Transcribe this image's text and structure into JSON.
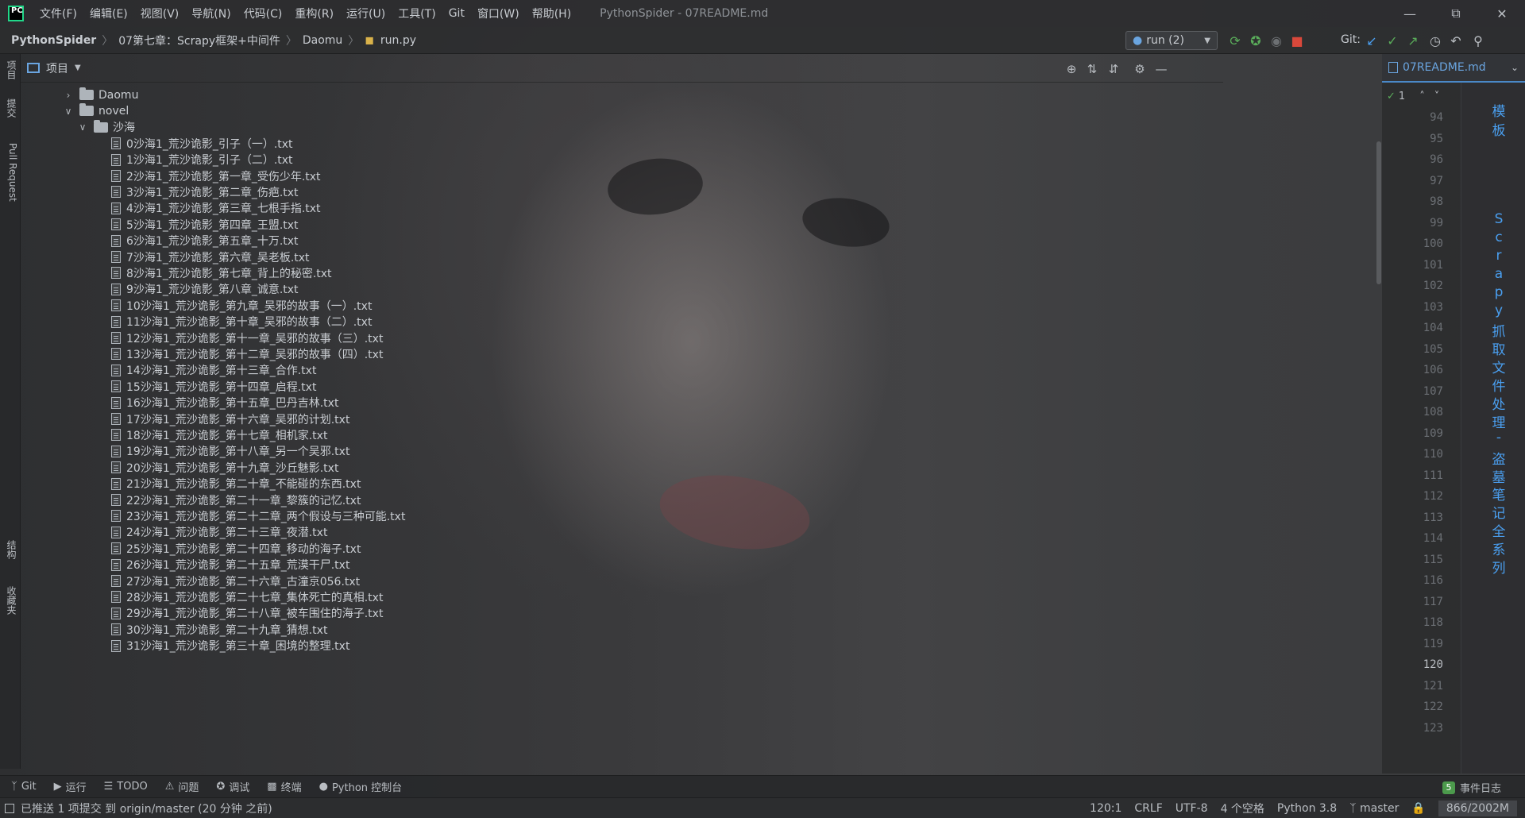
{
  "menu": {
    "items": [
      "文件(F)",
      "编辑(E)",
      "视图(V)",
      "导航(N)",
      "代码(C)",
      "重构(R)",
      "运行(U)",
      "工具(T)",
      "Git",
      "窗口(W)",
      "帮助(H)"
    ],
    "window_title": "PythonSpider - 07README.md"
  },
  "breadcrumb": {
    "items": [
      "PythonSpider",
      "07第七章：Scrapy框架+中间件",
      "Daomu",
      "run.py"
    ]
  },
  "toolbar": {
    "run_config": "run (2)",
    "git_label": "Git:"
  },
  "left_strip": {
    "tabs": [
      "项目",
      "提交",
      "Pull Request",
      "结构",
      "收藏夹"
    ]
  },
  "project_panel": {
    "title": "项目"
  },
  "tree": {
    "folders": [
      {
        "label": "Daomu",
        "expanded": false
      },
      {
        "label": "novel",
        "expanded": true
      },
      {
        "label": "沙海",
        "expanded": true
      }
    ],
    "files": [
      "0沙海1_荒沙诡影_引子（一）.txt",
      "1沙海1_荒沙诡影_引子（二）.txt",
      "2沙海1_荒沙诡影_第一章_受伤少年.txt",
      "3沙海1_荒沙诡影_第二章_伤疤.txt",
      "4沙海1_荒沙诡影_第三章_七根手指.txt",
      "5沙海1_荒沙诡影_第四章_王盟.txt",
      "6沙海1_荒沙诡影_第五章_十万.txt",
      "7沙海1_荒沙诡影_第六章_吴老板.txt",
      "8沙海1_荒沙诡影_第七章_背上的秘密.txt",
      "9沙海1_荒沙诡影_第八章_诚意.txt",
      "10沙海1_荒沙诡影_第九章_吴邪的故事（一）.txt",
      "11沙海1_荒沙诡影_第十章_吴邪的故事（二）.txt",
      "12沙海1_荒沙诡影_第十一章_吴邪的故事（三）.txt",
      "13沙海1_荒沙诡影_第十二章_吴邪的故事（四）.txt",
      "14沙海1_荒沙诡影_第十三章_合作.txt",
      "15沙海1_荒沙诡影_第十四章_启程.txt",
      "16沙海1_荒沙诡影_第十五章_巴丹吉林.txt",
      "17沙海1_荒沙诡影_第十六章_吴邪的计划.txt",
      "18沙海1_荒沙诡影_第十七章_相机家.txt",
      "19沙海1_荒沙诡影_第十八章_另一个吴邪.txt",
      "20沙海1_荒沙诡影_第十九章_沙丘魅影.txt",
      "21沙海1_荒沙诡影_第二十章_不能碰的东西.txt",
      "22沙海1_荒沙诡影_第二十一章_黎簇的记忆.txt",
      "23沙海1_荒沙诡影_第二十二章_两个假设与三种可能.txt",
      "24沙海1_荒沙诡影_第二十三章_夜潜.txt",
      "25沙海1_荒沙诡影_第二十四章_移动的海子.txt",
      "26沙海1_荒沙诡影_第二十五章_荒漠干尸.txt",
      "27沙海1_荒沙诡影_第二十六章_古潼京056.txt",
      "28沙海1_荒沙诡影_第二十七章_集体死亡的真相.txt",
      "29沙海1_荒沙诡影_第二十八章_被车围住的海子.txt",
      "30沙海1_荒沙诡影_第二十九章_猜想.txt",
      "31沙海1_荒沙诡影_第三十章_困境的整理.txt"
    ]
  },
  "editor": {
    "tab_label": "07README.md",
    "inspection_count": "1",
    "line_numbers": [
      "94",
      "95",
      "96",
      "97",
      "98",
      "99",
      "100",
      "101",
      "102",
      "103",
      "104",
      "105",
      "106",
      "107",
      "108",
      "109",
      "110",
      "111",
      "112",
      "113",
      "114",
      "115",
      "116",
      "117",
      "118",
      "119",
      "120",
      "121",
      "122",
      "123"
    ],
    "current_line": "120",
    "vertical_text": [
      "模",
      "板",
      "S",
      "c",
      "r",
      "a",
      "p",
      "y",
      "抓",
      "取",
      "文",
      "件",
      "处",
      "理",
      "-",
      "盗",
      "墓",
      "笔",
      "记",
      "全",
      "系",
      "列"
    ]
  },
  "bottom_tools": [
    {
      "icon": "git-branch-icon",
      "label": "Git"
    },
    {
      "icon": "run-icon",
      "label": "运行"
    },
    {
      "icon": "todo-icon",
      "label": "TODO"
    },
    {
      "icon": "problems-icon",
      "label": "问题"
    },
    {
      "icon": "debug-icon",
      "label": "调试"
    },
    {
      "icon": "terminal-icon",
      "label": "终端"
    },
    {
      "icon": "python-console-icon",
      "label": "Python 控制台"
    }
  ],
  "event_log": {
    "badge": "5",
    "label": "事件日志"
  },
  "status": {
    "message": "已推送 1 项提交 到 origin/master (20 分钟 之前)",
    "position": "120:1",
    "line_sep": "CRLF",
    "encoding": "UTF-8",
    "indent": "4 个空格",
    "interpreter": "Python 3.8",
    "branch": "master",
    "memory": "866/2002M"
  }
}
